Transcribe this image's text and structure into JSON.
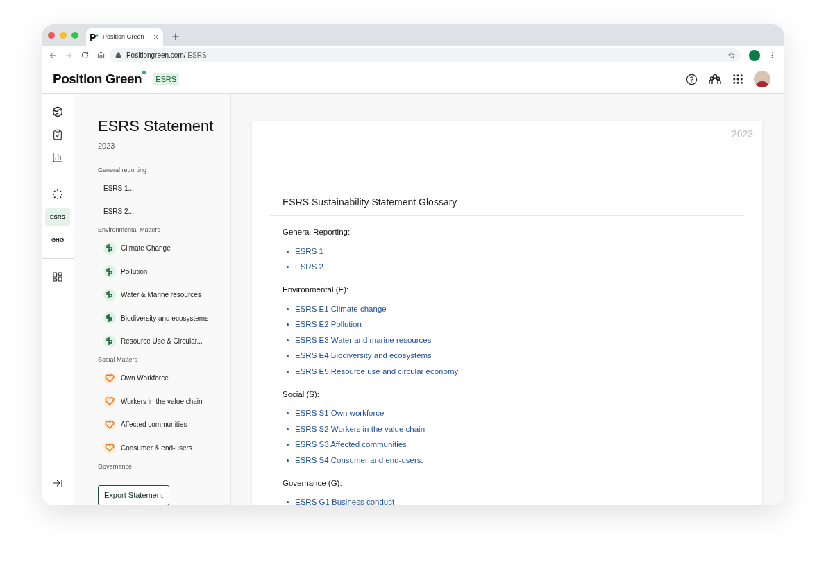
{
  "browser": {
    "tab_title": "Position Green",
    "url_host": "Positiongreen.com/",
    "url_path": " ESRS"
  },
  "header": {
    "logo": "Position Green",
    "badge": "ESRS"
  },
  "rail": [
    [
      {
        "kind": "icon",
        "selected": false
      },
      {
        "kind": "icon",
        "selected": false
      },
      {
        "kind": "icon",
        "selected": false
      }
    ],
    [
      {
        "kind": "icon",
        "selected": false
      },
      {
        "kind": "text",
        "label": "ESRS",
        "selected": true
      },
      {
        "kind": "text",
        "label": "GHG",
        "selected": false
      }
    ],
    [
      {
        "kind": "icon",
        "selected": false
      }
    ]
  ],
  "sidebar": {
    "title": "ESRS Statement",
    "year": "2023",
    "sections": [
      {
        "heading": "General reporting",
        "items": [
          {
            "label": "ESRS 1...",
            "kind": "plain"
          },
          {
            "label": "ESRS 2...",
            "kind": "plain"
          }
        ]
      },
      {
        "heading": "Environmental Matters",
        "items": [
          {
            "label": "Climate Change",
            "kind": "environment"
          },
          {
            "label": "Pollution",
            "kind": "environment"
          },
          {
            "label": "Water & Marine resources",
            "kind": "environment"
          },
          {
            "label": "Biodiversity and ecosystems",
            "kind": "environment"
          },
          {
            "label": "Resource Use & Circular...",
            "kind": "environment"
          }
        ]
      },
      {
        "heading": "Social Matters",
        "items": [
          {
            "label": "Own Workforce",
            "kind": "social"
          },
          {
            "label": "Workers in the value chain",
            "kind": "social"
          },
          {
            "label": "Affected communities",
            "kind": "social"
          },
          {
            "label": "Consumer & end-users",
            "kind": "social"
          }
        ]
      },
      {
        "heading": "Governance"
      }
    ],
    "export_button": "Export Statement"
  },
  "document": {
    "year": "2023",
    "title": "ESRS Sustainability Statement Glossary",
    "sections": [
      {
        "heading": "General Reporting:",
        "links": [
          "ESRS 1",
          "ESRS 2"
        ]
      },
      {
        "heading": "Environmental (E):",
        "links": [
          "ESRS E1 Climate change",
          "ESRS E2 Pollution",
          "ESRS E3 Water and marine resources",
          "ESRS E4 Biodiversity and ecosystems",
          "ESRS E5 Resource use and circular economy"
        ]
      },
      {
        "heading": "Social (S):",
        "links": [
          "ESRS S1 Own workforce",
          "ESRS S2 Workers in the value chain",
          "ESRS S3 Affected communities",
          "ESRS S4 Consumer and end-users."
        ]
      },
      {
        "heading": "Governance (G):",
        "links": [
          "ESRS G1 Business conduct"
        ]
      }
    ]
  }
}
